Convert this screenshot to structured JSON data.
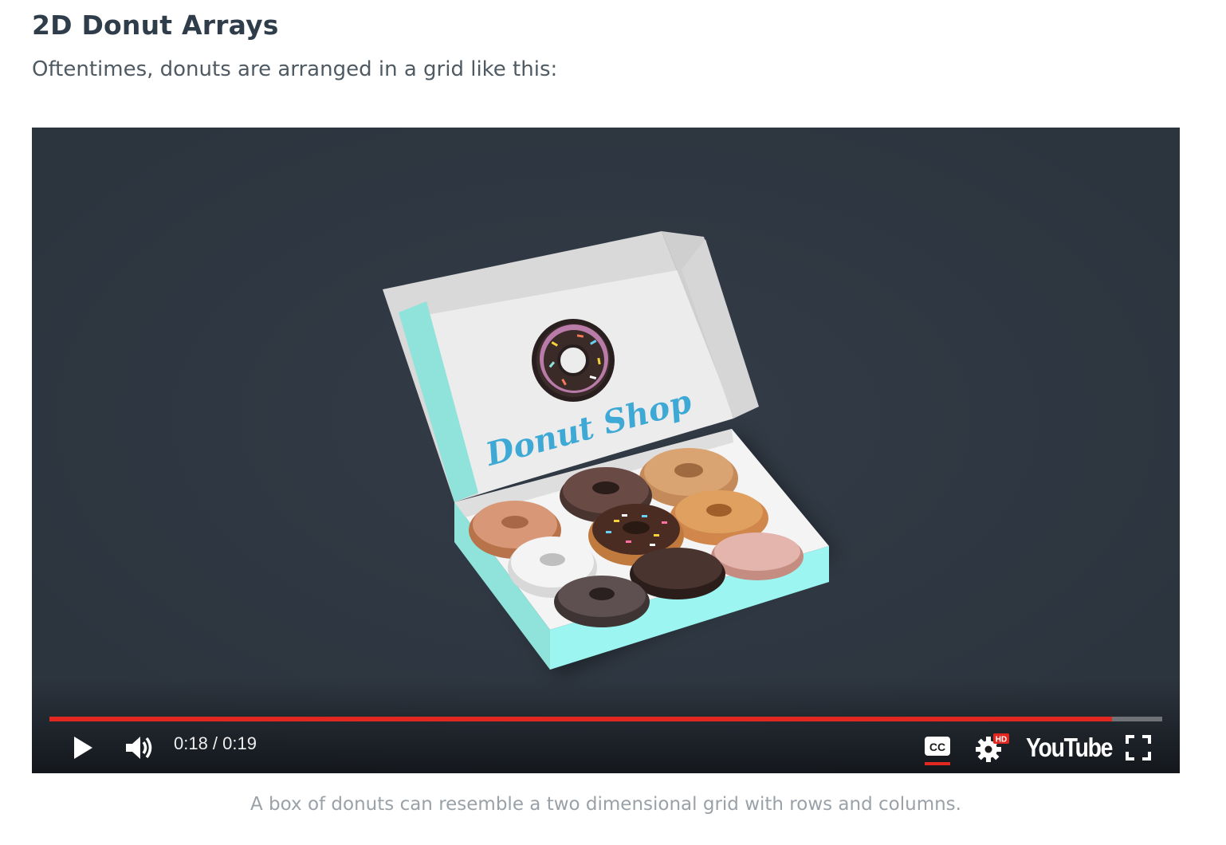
{
  "page": {
    "title": "2D Donut Arrays",
    "intro": "Oftentimes, donuts are arranged in a grid like this:",
    "caption": "A box of donuts can resemble a two dimensional grid with rows and columns."
  },
  "video": {
    "box_label": "Donut Shop",
    "current_time": "0:18 / 0:19",
    "progress": 0.955,
    "hd_badge": "HD",
    "logo_text": "YouTube",
    "cc_label": "CC",
    "colors": {
      "background": "#2e3640",
      "progress": "#e1271f",
      "box_teal": "#8fe3da",
      "box_label": "#3fa9d6"
    },
    "controls": {
      "play": "play-icon",
      "volume": "volume-icon",
      "captions": "closed-captions-icon",
      "settings": "gear-icon",
      "fullscreen": "fullscreen-icon"
    }
  }
}
